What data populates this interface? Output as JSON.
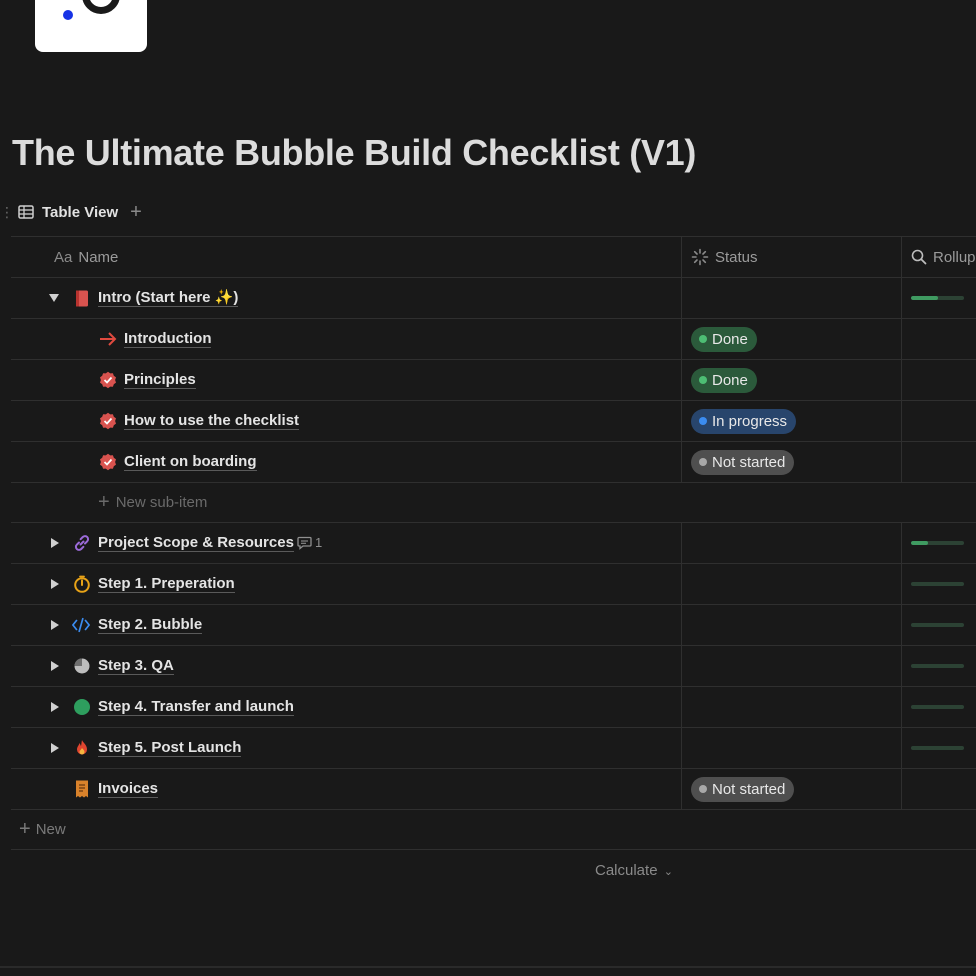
{
  "page": {
    "title": "The Ultimate Bubble Build Checklist (V1)",
    "logo_name": "logo"
  },
  "view": {
    "tab_label": "Table View",
    "add_symbol": "+"
  },
  "columns": {
    "name": {
      "icon": "Aa",
      "label": "Name"
    },
    "status": {
      "icon": "status-spinner-icon",
      "label": "Status"
    },
    "rollup": {
      "icon": "search-icon",
      "label": "Rollup"
    }
  },
  "rows": [
    {
      "label": "Intro (Start here ✨)",
      "icon": "red-book-icon",
      "toggle": "expanded",
      "level": 0,
      "status": "",
      "rollup_progress": 0.5
    },
    {
      "label": "Introduction",
      "icon": "arrow-right-icon",
      "level": 1,
      "status": "Done",
      "status_color": "#2b5a3b"
    },
    {
      "label": "Principles",
      "icon": "check-badge-icon",
      "level": 1,
      "status": "Done",
      "status_color": "#2b5a3b"
    },
    {
      "label": "How to use the checklist",
      "icon": "check-badge-icon",
      "level": 1,
      "status": "In progress",
      "status_color": "#28456c"
    },
    {
      "label": "Client on boarding",
      "icon": "check-badge-icon",
      "level": 1,
      "status": "Not started",
      "status_color": "#4f4f4f"
    },
    {
      "label": "Project Scope & Resources",
      "icon": "link-icon",
      "toggle": "collapsed",
      "level": 0,
      "comment_count": "1",
      "rollup_progress": 0.33
    },
    {
      "label": "Step 1. Preperation",
      "icon": "timer-icon",
      "toggle": "collapsed",
      "level": 0,
      "rollup_progress": 0
    },
    {
      "label": "Step 2. Bubble",
      "icon": "code-icon",
      "toggle": "collapsed",
      "level": 0,
      "rollup_progress": 0
    },
    {
      "label": "Step 3. QA",
      "icon": "pie-icon",
      "toggle": "collapsed",
      "level": 0,
      "rollup_progress": 0
    },
    {
      "label": "Step 4. Transfer and launch",
      "icon": "green-circle-icon",
      "toggle": "collapsed",
      "level": 0,
      "rollup_progress": 0
    },
    {
      "label": "Step 5. Post Launch",
      "icon": "fire-icon",
      "toggle": "collapsed",
      "level": 0,
      "rollup_progress": 0
    },
    {
      "label": "Invoices",
      "icon": "receipt-icon",
      "level": 0,
      "status": "Not started",
      "status_color": "#4f4f4f"
    }
  ],
  "new_sub_item_label": "New sub-item",
  "new_label": "New",
  "calculate_label": "Calculate",
  "colors": {
    "background": "#191919",
    "done": "#2b5a3b",
    "in_progress": "#28456c",
    "not_started": "#4f4f4f",
    "progress_fill": "#3f9b61"
  }
}
